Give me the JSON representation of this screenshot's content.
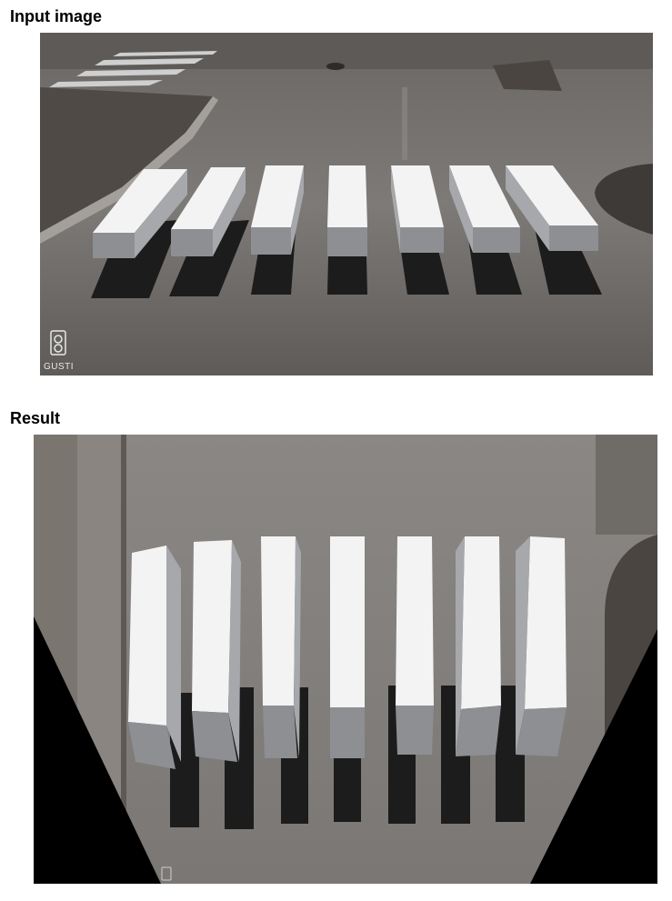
{
  "figure": {
    "input_title": "Input image",
    "result_title": "Result"
  },
  "input_image": {
    "description_icon": "camera-icon",
    "watermark_text": "GUSTI",
    "stripe_count": 7
  },
  "result_image": {
    "stripe_count": 7,
    "warp_fill_color": "#000000"
  },
  "colors": {
    "road": "#7f7c79",
    "stripe_top": "#f4f4f4",
    "stripe_side": "#8f9194",
    "shadow": "#1c1c1c",
    "sidewalk": "#5e5955"
  }
}
